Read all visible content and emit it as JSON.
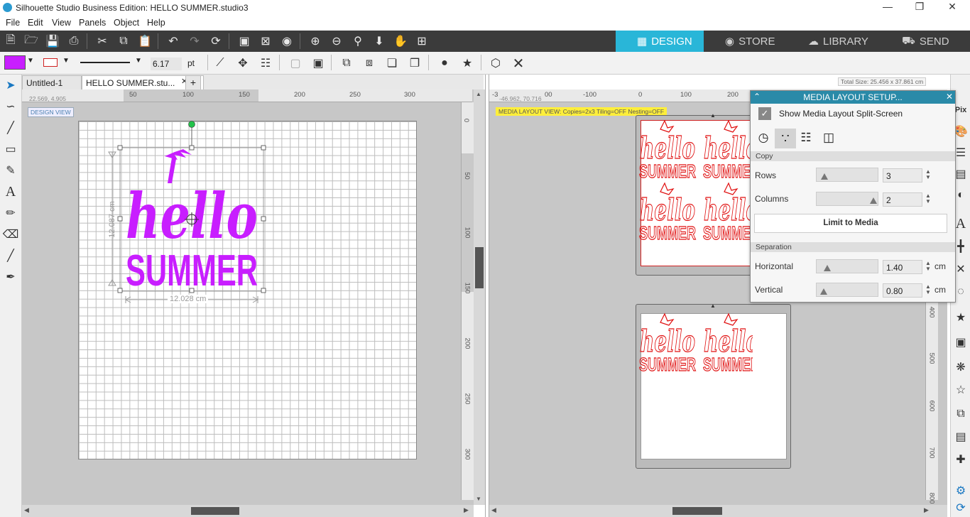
{
  "window": {
    "title": "Silhouette Studio Business Edition: HELLO SUMMER.studio3"
  },
  "menu": [
    "File",
    "Edit",
    "View",
    "Panels",
    "Object",
    "Help"
  ],
  "nav_tabs": [
    {
      "label": "DESIGN",
      "icon": "grid-icon",
      "active": true
    },
    {
      "label": "STORE",
      "icon": "silhouette-s-icon",
      "active": false
    },
    {
      "label": "LIBRARY",
      "icon": "cloud-icon",
      "active": false
    },
    {
      "label": "SEND",
      "icon": "cutter-icon",
      "active": false
    }
  ],
  "style": {
    "fill_color": "#c81eff",
    "line_width": "6.17",
    "line_unit": "pt"
  },
  "doc_tabs": [
    "Untitled-1",
    "HELLO SUMMER.stu...",
    "+"
  ],
  "left_view": {
    "label": "DESIGN VIEW",
    "coords": "22.569, 4.905",
    "hruler": [
      "50",
      "50",
      "100",
      "150",
      "200",
      "250",
      "300"
    ],
    "vruler": [
      "0",
      "50",
      "100",
      "150",
      "200",
      "250",
      "300"
    ],
    "design_text_1": "hello",
    "design_text_2": "SUMMER",
    "height_label": "12.087 cm",
    "width_label": "12.028 cm",
    "design_color": "#c81eff"
  },
  "right_view": {
    "banner": "MEDIA LAYOUT VIEW:  Copies=2x3   Tiling=OFF   Nesting=OFF",
    "coords": "-46.962, 70.716",
    "total_size": "Total Size: 25.456 x 37.861 cm",
    "hruler": [
      "-3",
      "00",
      "-100",
      "0",
      "100",
      "200"
    ],
    "vruler": [
      "400",
      "500",
      "600",
      "700",
      "800"
    ],
    "copy_text_1": "hello",
    "copy_text_2": "SUMMER",
    "copy_color": "#e01010"
  },
  "media_panel": {
    "title": "MEDIA LAYOUT SETUP...",
    "split_label": "Show Media Layout Split-Screen",
    "split_checked": true,
    "copy_section": "Copy",
    "rows_label": "Rows",
    "rows_value": "3",
    "columns_label": "Columns",
    "columns_value": "2",
    "limit_button": "Limit to Media",
    "sep_section": "Separation",
    "horizontal_label": "Horizontal",
    "horizontal_value": "1.40",
    "vertical_label": "Vertical",
    "vertical_value": "0.80",
    "unit": "cm"
  },
  "right_tools_labels": {
    "pix": "Pix",
    "text": "A"
  }
}
